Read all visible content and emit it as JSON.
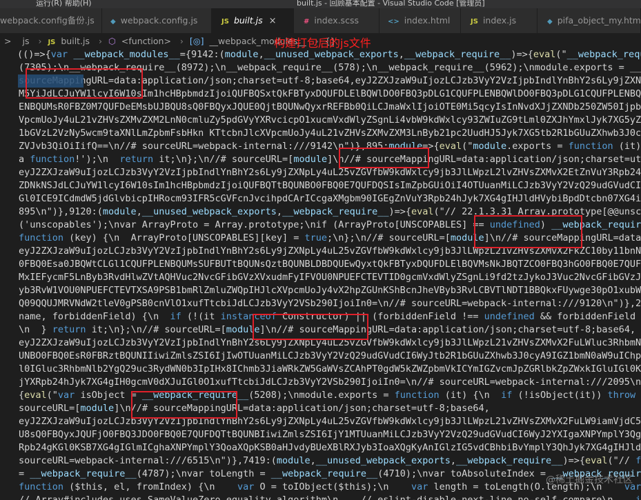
{
  "titlebar": {
    "menu": "运行(R)    帮助(H)",
    "title": "built.js - 回顾基本配置 - Visual Studio Code [管理员]"
  },
  "tabs": [
    {
      "icon": "",
      "icon_class": "ico-wp",
      "label": "webpack.config备份.js",
      "active": false,
      "close": ""
    },
    {
      "icon": "◆",
      "icon_class": "ico-wp",
      "label": "webpack.config.js",
      "active": false,
      "close": ""
    },
    {
      "icon": "JS",
      "icon_class": "ico-js",
      "label": "built.js",
      "active": true,
      "close": "×"
    },
    {
      "icon": "#",
      "icon_class": "ico-scss",
      "label": "index.scss",
      "active": false,
      "close": ""
    },
    {
      "icon": "<>",
      "icon_class": "ico-html",
      "label": "index.html",
      "active": false,
      "close": ""
    },
    {
      "icon": "JS",
      "icon_class": "ico-js",
      "label": "index.js",
      "active": false,
      "close": ""
    },
    {
      "icon": "◆",
      "icon_class": "ico-obj",
      "label": "pifa_object_my.html",
      "active": false,
      "close": ""
    }
  ],
  "breadcrumb": {
    "lead": ">",
    "folder": "js",
    "js_icon": "JS",
    "file": "built.js",
    "fn_icon": "⬡",
    "fn": "<function>",
    "var_icon": "[◎]",
    "var": "__webpack_modules__",
    "trail": "{}"
  },
  "annotation": "构建打包后的js文件",
  "watermark": "@稀土掘金技术社区",
  "code_lines": [
    "(()=>{var __webpack_modules__={9142:(module,__unused_webpack_exports,__webpack_require__)=>{eval(\"__webpack_require__",
    "(7305);\\n__webpack_require__(8972);\\n__webpack_require__(578);\\n__webpack_require__(5962);\\nmodule.exports = __webpack",
    "sourceMappingURL=data:application/json;charset=utf-8;base64,eyJ2ZXJzaW9uIjozLCJzb3VyY2VzIjpbIndlYnBhY2s6Ly9jZXNpLy4uL",
    "M5YiJdLCJuYW1lcyI6W10sIm1hcHBpbmdzIjoiQUFBQSxtQkFBTyxDQUFDLElBQWlDO0FBQ3pDLG1CQUFPLENBQWlDO0FBQ3pDLG1CQUFPLENBQWlDO0FB",
    "ENBQUMsR0FBZ0M7QUFDeEMsbUJBQU8sQ0FBQyxJQUE0QjtBQUNwQyxrREFBb0QiLCJmaWxlIjoiOTE0Mi5qcyIsInNvdXJjZXNDb250ZW50IjpbInJlcXV",
    "VpcmUoJy4uL21vZHVsZXMvZXM2LnN0cmluZy5pdGVyYXRvcicpO1xucmVxdWlyZSgnLi4vbW9kdWxlcy93ZWIuZG9tLml0ZXJhYmxlJyk7XG5yZXF1aXJl",
    "1bGVzL2VzNy5wcm9taXNlLmZpbmFsbHkn KTtcbnJlcXVpcmUoJy4uL21vZHVsZXMvZXM3LnByb21pc2UudHJ5Jyk7XG5tb2R1bGUuZXhwb3J0cyA9IHJl",
    "ZVJvb3QiOiIifQ==\\n//# sourceURL=webpack-internal:///9142\\n\")},895:module=>{eval(\"module.exports = function (it) {\\n  i",
    "a function!');\\n  return it;\\n};\\n//# sourceURL=[module]\\n//# sourceMappingURL=data:application/json;charset=utf-8;bas",
    "eyJ2ZXJzaW9uIjozLCJzb3VyY2VzIjpbIndlYnBhY2s6Ly9jZXNpLy4uL25vZGVfbW9kdWxlcy9jb3JlLWpzL2lvZHVsZXMvX2EtZnVuY3Rpb24uanM",
    "ZDNkNSJdLCJuYW1lcyI6W10sIm1hcHBpbmdzIjoiQUFBQTtBQUNBO0FBQ0E7QUFDQSIsImZpbGUiOiI4OTUuanMiLCJzb3VyY2VzQ29udGVudCI6WyJtb2",
    "Gl0ICE9ICdmdW5jdGlvbicpIHRocm93IFR5cGVFcnJvcihpdCArICcgaXMgbm90IGEgZnVuY3Rpb24hJyk7XG4gIHJldHVybiBpdDtcbn07XG4iXSwic29",
    "895\\n\")},9120:(module,__unused_webpack_exports,__webpack_require__)=>{eval(\"// 22.1.3.31 Array.prototype[@@unscopables",
    "('unscopables');\\nvar ArrayProto = Array.prototype;\\nif (ArrayProto[UNSCOPABLES] == undefined) __webpack_require__(407",
    "function (key) {\\n  ArrayProto[UNSCOPABLES][key] = true;\\n};\\n//# sourceURL=[module]\\n//# sourceMappingURL=data:applic",
    "eyJ2ZXJzaW9uIjozLCJzb3VyY2VzIjpbIndlYnBhY2s6Ly9jZXNpLy4uL25vZGVfbW9kdWxlcy9jb3JlLWpzL21vZHVsZXMvX2FkZC10by11bnNjb3",
    "0FBQ0Esa0JBQWtCLGl1CQUFPLENBQUMsSUFBUTtBQUNsQztBQUNBLDBDQUEwQyxtQkFBTyxDQUFDLElBQVMsNkJBQTZCO0FBQ3hGO0FBQ0E7QUFDQSIsIm",
    "MxIEFycmF5LnByb3RvdHlwZVtAQHVuc2NvcGFibGVzXVxudmFyIFVOU0NPUEFCTEVTID0gcmVxdWlyZSgnLi9fd2tzJykoJ3Vuc2NvcGFibGVzJyk7XG5",
    "yb3RvW1VOU0NPUEFCTEVTXSA9PSB1bmRlZmluZWQpIHJlcXVpcmUoJy4vX2hpZGUnKShBcnJheVByb3RvLCBVTlNDT1BBQkxFUywge30pO1xubW9kdWxlLm",
    "Q09QQUJMRVNdW2tleV0gPSB0cnVlO1xufTtcbiJdLCJzb3VyY2VSb290IjoiIn0=\\n//# sourceURL=webpack-internal:///9120\\n\")},2095:mod",
    "name, forbiddenField) {\\n  if (!(it instanceof Constructor) || (forbiddenField !== undefined && forbiddenField in it))",
    "\\n  } return it;\\n};\\n//# sourceURL=[module]\\n//# sourceMappingURL=data:application/json;charset=utf-8;base64,",
    "eyJ2ZXJzaW9uIjozLCJzb3VyY2VzIjpbIndlYnBhY2s6Ly9jZXNpLy4uL25vZGVfbW9kdWxlcy9jb3JlLWpzL21vZHVsZXMvX2FuLWluc3RhbmNlLmpz",
    "UNBO0FBQ0EsR0FBRztBQUNIIiwiZmlsZSI6IjIwOTUuanMiLCJzb3VyY2VzQ29udGVudCI6WyJtb2R1bGUuZXhwb3J0cyA9IGZ1bmN0aW9uIChpdCwgQ29",
    "l0IGluc3RhbmNlb2YgQ29uc3RydWN0b3IpIHx8IChmb3JiaWRkZW5GaWVsZCAhPT0gdW5kZWZpbmVkICYmIGZvcmJpZGRlbkZpZWxkIGluIGl0KSkge1xuI",
    "jYXRpb24hJyk7XG4gIH0gcmV0dXJuIGl0O1xufTtcbiJdLCJzb3VyY2VSb290IjoiIn0=\\n//# sourceURL=webpack-internal:///2095\\n\")},65",
    "{eval(\"var isObject = __webpack_require__(5208);\\nmodule.exports = function (it) {\\n  if (!isObject(it)) throw TypeEr",
    "sourceURL=[module]\\n//# sourceMappingURL=data:application/json;charset=utf-8;base64,",
    "eyJ2ZXJzaW9uIjozLCJzb3VyY2VzIjpbIndlYnBhY2s6Ly9jZXNpLy4uL25vZGVfbW9kdWxlcy9jb3JlLWpzL21vZHVsZXMvX2FuLW9iamVjdC5qcyJd",
    "U8sQ0FBQyxJQUFjO0FBQ3JDO0FBQ0E7QUFDQTtBQUNBIiwiZmlsZSI6IjY1MTUuanMiLCJzb3VyY2VzQ29udGVudCI6WyJ2YXIgaXNPYmplY3QgPSByZXF",
    "Rpb24gKGl0KSB7XG4gIGlmICghaXNPYmplY3QoaXQpKSB0aHJvdyBUeXBlRXJyb3IoaXQgKyAnIGlzIG5vdCBhbiBvYmplY3QhJyk7XG4gIHJldHVybiBp",
    "sourceURL=webpack-internal:///6515\\n\")},7419:(module,__unused_webpack_exports,__webpack_require__)=>{eval(\"// false -",
    "= __webpack_require__(4787);\\nvar toLength = __webpack_require__(4710);\\nvar toAbsoluteIndex = __webpack_require__(264",
    "function ($this, el, fromIndex) {\\n    var O = toIObject($this);\\n    var length = toLength(O.length);\\n    var index",
    "// Array#includes uses SameValueZero equality algorithm\\n    // eslint-disable-next-line no-self-compare\\n    if (IS_INC"
  ],
  "colors": {
    "highlight_box": "#e0202a",
    "annotation": "#ff2020",
    "background": "#1e1e1e"
  }
}
